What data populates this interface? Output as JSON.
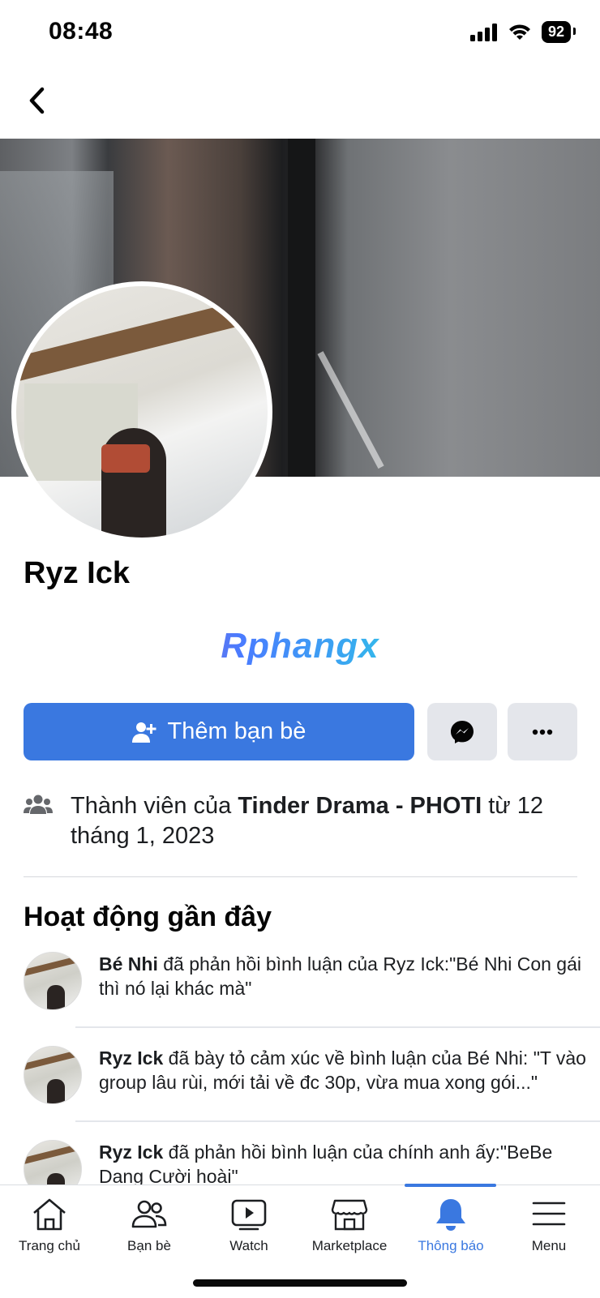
{
  "status_bar": {
    "time": "08:48",
    "battery": "92"
  },
  "profile": {
    "name": "Ryz Ick"
  },
  "watermark": "Rphangx",
  "actions": {
    "add_friend_label": "Thêm bạn bè"
  },
  "membership": {
    "prefix": "Thành viên của ",
    "group": "Tinder Drama - PHOTI",
    "suffix": " từ 12 tháng 1, 2023"
  },
  "recent_activity": {
    "title": "Hoạt động gần đây",
    "items": [
      {
        "actor": "Bé Nhi",
        "text": "  đã phản hồi bình luận của Ryz Ick:\"Bé Nhi Con gái thì nó lại khác mà\""
      },
      {
        "actor": "Ryz Ick",
        "text": " đã bày tỏ cảm xúc về bình luận của Bé Nhi: \"T vào group lâu rùi, mới tải về đc 30p, vừa mua xong gói...\""
      },
      {
        "actor": "Ryz Ick",
        "text": " đã phản hồi bình luận của chính anh ấy:\"BeBe Dang Cười hoài\""
      }
    ]
  },
  "tabs": [
    {
      "label": "Trang chủ",
      "icon": "home-icon"
    },
    {
      "label": "Bạn bè",
      "icon": "friends-icon"
    },
    {
      "label": "Watch",
      "icon": "watch-icon"
    },
    {
      "label": "Marketplace",
      "icon": "marketplace-icon"
    },
    {
      "label": "Thông báo",
      "icon": "bell-icon",
      "active": true
    },
    {
      "label": "Menu",
      "icon": "menu-icon"
    }
  ],
  "colors": {
    "accent": "#3a78e0",
    "button_gray": "#e4e6eb"
  }
}
